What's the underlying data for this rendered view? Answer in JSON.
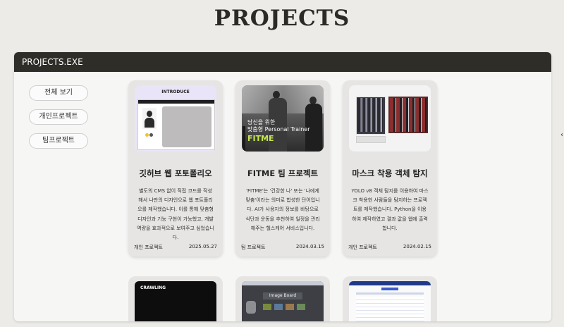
{
  "page": {
    "title": "PROJECTS"
  },
  "window": {
    "title": "PROJECTS.EXE"
  },
  "filters": [
    {
      "label": "전체 보기"
    },
    {
      "label": "개인프로젝트"
    },
    {
      "label": "팀프로젝트"
    }
  ],
  "projects": [
    {
      "title": "깃허브 웹 포토폴리오",
      "thumb_heading": "INTRODUCE",
      "desc": "별도의 CMS 없이 직접 코드를 작성해서 나만의 디자인으로 웹 포트폴리오를 제작했습니다. 이를 통해 맞춤형 디자인과 기능 구현이 가능했고, 개발 역량을 효과적으로 보여주고 싶었습니다.",
      "type": "개인 프로젝트",
      "date": "2025.05.27"
    },
    {
      "title": "FITME 팀 프로젝트",
      "thumb_line1": "당신을 위한",
      "thumb_line2": "맞춤형 Personal Trainer",
      "thumb_brand": "FITME",
      "desc": "'FITME'는 '건강한 나' 또는 '나에게 맞춤'이라는 의미로 합성한 단어입니다. AI가 사용자의 정보를 바탕으로 식단과 운동을 추천하여 일정을 관리해주는 헬스케어 서비스입니다.",
      "type": "팀 프로젝트",
      "date": "2024.03.15"
    },
    {
      "title": "마스크 착용 객체 탐지",
      "desc": "YOLO v8 객체 탐지를 이용하여 마스크 착용한 사람들을 탐지하는 프로젝트를 제작했습니다. Python을 이용하여 제작하였고 결과 값을 웹에 출력합니다.",
      "type": "개인 프로젝트",
      "date": "2024.02.15"
    }
  ],
  "more_projects": [
    {
      "thumb_text": "CRAWLING"
    },
    {
      "thumb_text": "Image Board"
    },
    {
      "thumb_text": ""
    }
  ],
  "colors": {
    "titlebar": "#2f2d27",
    "page_bg": "#ecebe8",
    "accent_green": "#c6e84a"
  },
  "icons": {
    "edge": "chevron-left-icon"
  }
}
